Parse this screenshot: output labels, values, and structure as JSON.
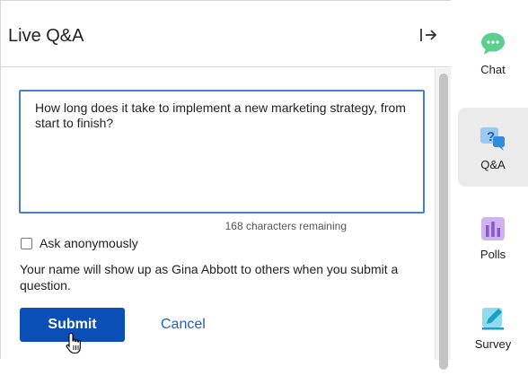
{
  "header": {
    "title": "Live Q&A"
  },
  "question": {
    "value": "How long does it take to implement a new marketing strategy, from start to finish?",
    "remaining": "168 characters remaining"
  },
  "anonymous": {
    "label": "Ask anonymously",
    "checked": false
  },
  "note": "Your name will show up as Gina Abbott to others when you submit a question.",
  "actions": {
    "submit_label": "Submit",
    "cancel_label": "Cancel"
  },
  "sidebar": {
    "items": [
      {
        "label": "Chat",
        "icon": "chat-icon",
        "color": "#3cbf7a"
      },
      {
        "label": "Q&A",
        "icon": "qa-icon",
        "color": "#2f8de0",
        "active": true
      },
      {
        "label": "Polls",
        "icon": "polls-icon",
        "color": "#9b6ad6"
      },
      {
        "label": "Survey",
        "icon": "survey-icon",
        "color": "#2fb3d8"
      }
    ]
  },
  "colors": {
    "primary": "#0a4fb5",
    "focus_border": "#4a7fd0",
    "link": "#1f5fc7"
  }
}
